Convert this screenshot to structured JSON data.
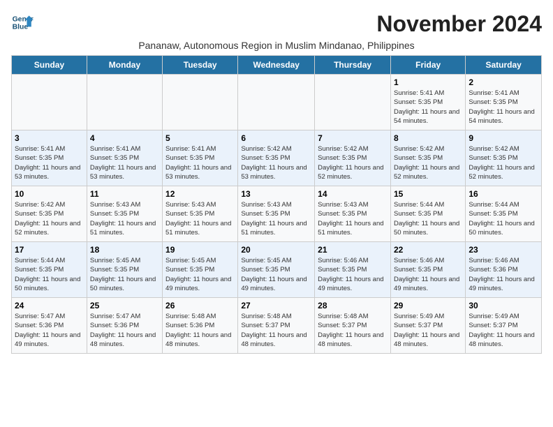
{
  "logo": {
    "line1": "General",
    "line2": "Blue"
  },
  "title": "November 2024",
  "subtitle": "Pananaw, Autonomous Region in Muslim Mindanao, Philippines",
  "days_of_week": [
    "Sunday",
    "Monday",
    "Tuesday",
    "Wednesday",
    "Thursday",
    "Friday",
    "Saturday"
  ],
  "weeks": [
    {
      "cells": [
        {
          "day": "",
          "info": ""
        },
        {
          "day": "",
          "info": ""
        },
        {
          "day": "",
          "info": ""
        },
        {
          "day": "",
          "info": ""
        },
        {
          "day": "",
          "info": ""
        },
        {
          "day": "1",
          "info": "Sunrise: 5:41 AM\nSunset: 5:35 PM\nDaylight: 11 hours and 54 minutes."
        },
        {
          "day": "2",
          "info": "Sunrise: 5:41 AM\nSunset: 5:35 PM\nDaylight: 11 hours and 54 minutes."
        }
      ]
    },
    {
      "cells": [
        {
          "day": "3",
          "info": "Sunrise: 5:41 AM\nSunset: 5:35 PM\nDaylight: 11 hours and 53 minutes."
        },
        {
          "day": "4",
          "info": "Sunrise: 5:41 AM\nSunset: 5:35 PM\nDaylight: 11 hours and 53 minutes."
        },
        {
          "day": "5",
          "info": "Sunrise: 5:41 AM\nSunset: 5:35 PM\nDaylight: 11 hours and 53 minutes."
        },
        {
          "day": "6",
          "info": "Sunrise: 5:42 AM\nSunset: 5:35 PM\nDaylight: 11 hours and 53 minutes."
        },
        {
          "day": "7",
          "info": "Sunrise: 5:42 AM\nSunset: 5:35 PM\nDaylight: 11 hours and 52 minutes."
        },
        {
          "day": "8",
          "info": "Sunrise: 5:42 AM\nSunset: 5:35 PM\nDaylight: 11 hours and 52 minutes."
        },
        {
          "day": "9",
          "info": "Sunrise: 5:42 AM\nSunset: 5:35 PM\nDaylight: 11 hours and 52 minutes."
        }
      ]
    },
    {
      "cells": [
        {
          "day": "10",
          "info": "Sunrise: 5:42 AM\nSunset: 5:35 PM\nDaylight: 11 hours and 52 minutes."
        },
        {
          "day": "11",
          "info": "Sunrise: 5:43 AM\nSunset: 5:35 PM\nDaylight: 11 hours and 51 minutes."
        },
        {
          "day": "12",
          "info": "Sunrise: 5:43 AM\nSunset: 5:35 PM\nDaylight: 11 hours and 51 minutes."
        },
        {
          "day": "13",
          "info": "Sunrise: 5:43 AM\nSunset: 5:35 PM\nDaylight: 11 hours and 51 minutes."
        },
        {
          "day": "14",
          "info": "Sunrise: 5:43 AM\nSunset: 5:35 PM\nDaylight: 11 hours and 51 minutes."
        },
        {
          "day": "15",
          "info": "Sunrise: 5:44 AM\nSunset: 5:35 PM\nDaylight: 11 hours and 50 minutes."
        },
        {
          "day": "16",
          "info": "Sunrise: 5:44 AM\nSunset: 5:35 PM\nDaylight: 11 hours and 50 minutes."
        }
      ]
    },
    {
      "cells": [
        {
          "day": "17",
          "info": "Sunrise: 5:44 AM\nSunset: 5:35 PM\nDaylight: 11 hours and 50 minutes."
        },
        {
          "day": "18",
          "info": "Sunrise: 5:45 AM\nSunset: 5:35 PM\nDaylight: 11 hours and 50 minutes."
        },
        {
          "day": "19",
          "info": "Sunrise: 5:45 AM\nSunset: 5:35 PM\nDaylight: 11 hours and 49 minutes."
        },
        {
          "day": "20",
          "info": "Sunrise: 5:45 AM\nSunset: 5:35 PM\nDaylight: 11 hours and 49 minutes."
        },
        {
          "day": "21",
          "info": "Sunrise: 5:46 AM\nSunset: 5:35 PM\nDaylight: 11 hours and 49 minutes."
        },
        {
          "day": "22",
          "info": "Sunrise: 5:46 AM\nSunset: 5:35 PM\nDaylight: 11 hours and 49 minutes."
        },
        {
          "day": "23",
          "info": "Sunrise: 5:46 AM\nSunset: 5:36 PM\nDaylight: 11 hours and 49 minutes."
        }
      ]
    },
    {
      "cells": [
        {
          "day": "24",
          "info": "Sunrise: 5:47 AM\nSunset: 5:36 PM\nDaylight: 11 hours and 49 minutes."
        },
        {
          "day": "25",
          "info": "Sunrise: 5:47 AM\nSunset: 5:36 PM\nDaylight: 11 hours and 48 minutes."
        },
        {
          "day": "26",
          "info": "Sunrise: 5:48 AM\nSunset: 5:36 PM\nDaylight: 11 hours and 48 minutes."
        },
        {
          "day": "27",
          "info": "Sunrise: 5:48 AM\nSunset: 5:37 PM\nDaylight: 11 hours and 48 minutes."
        },
        {
          "day": "28",
          "info": "Sunrise: 5:48 AM\nSunset: 5:37 PM\nDaylight: 11 hours and 48 minutes."
        },
        {
          "day": "29",
          "info": "Sunrise: 5:49 AM\nSunset: 5:37 PM\nDaylight: 11 hours and 48 minutes."
        },
        {
          "day": "30",
          "info": "Sunrise: 5:49 AM\nSunset: 5:37 PM\nDaylight: 11 hours and 48 minutes."
        }
      ]
    }
  ]
}
